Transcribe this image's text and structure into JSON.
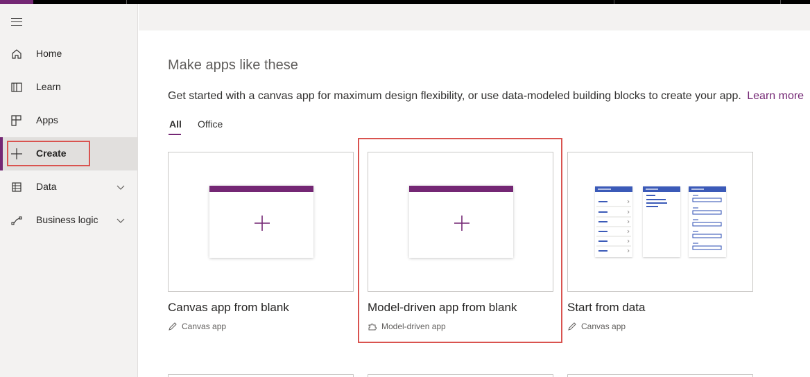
{
  "sidebar": {
    "menu_icon": "hamburger-icon",
    "items": [
      {
        "label": "Home",
        "icon": "home-icon"
      },
      {
        "label": "Learn",
        "icon": "book-icon"
      },
      {
        "label": "Apps",
        "icon": "apps-icon"
      },
      {
        "label": "Create",
        "icon": "plus-icon",
        "active": true
      },
      {
        "label": "Data",
        "icon": "table-icon",
        "expandable": true
      },
      {
        "label": "Business logic",
        "icon": "flow-icon",
        "expandable": true
      }
    ]
  },
  "main": {
    "heading": "Make apps like these",
    "description": "Get started with a canvas app for maximum design flexibility, or use data-modeled building blocks to create your app.",
    "learn_more": "Learn more",
    "tabs": [
      {
        "label": "All",
        "active": true
      },
      {
        "label": "Office",
        "active": false
      }
    ],
    "cards": [
      {
        "title": "Canvas app from blank",
        "subtitle": "Canvas app",
        "sub_icon": "pencil-icon"
      },
      {
        "title": "Model-driven app from blank",
        "subtitle": "Model-driven app",
        "sub_icon": "puzzle-icon",
        "highlighted": true
      },
      {
        "title": "Start from data",
        "subtitle": "Canvas app",
        "sub_icon": "pencil-icon"
      }
    ]
  },
  "colors": {
    "accent": "#742774",
    "highlight_border": "#d9534f",
    "sidebar_bg": "#f3f2f1",
    "data_blue": "#3b5ab8"
  }
}
